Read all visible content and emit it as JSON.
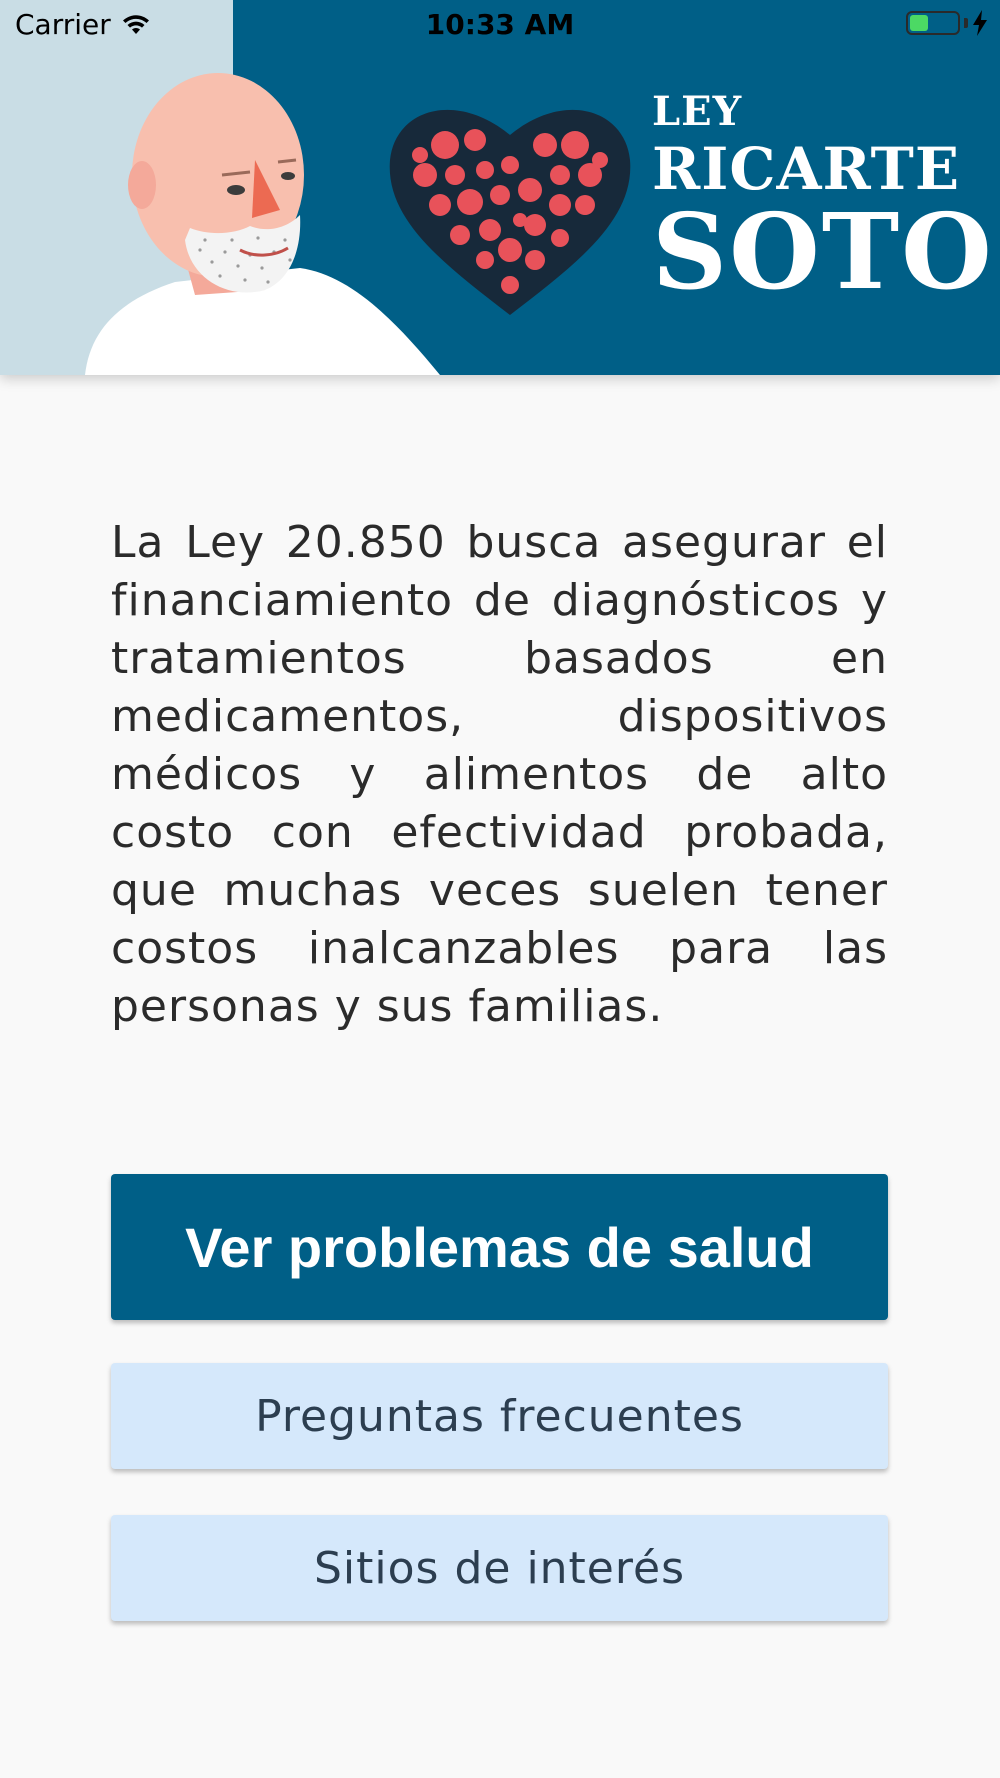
{
  "status_bar": {
    "carrier": "Carrier",
    "time": "10:33 AM",
    "battery_level": 0.4
  },
  "banner": {
    "logo_line1": "LEY",
    "logo_line2": "RICARTE",
    "logo_line3": "SOTO",
    "colors": {
      "background": "#005f87",
      "heart": "#e8525a",
      "heart_outline": "#17293a"
    }
  },
  "intro_text": "La Ley 20.850 busca asegurar el financiamiento de diagnósticos y tratamientos basados en medicamentos, dispositivos médicos y alimentos de alto costo con efectividad probada, que muchas veces suelen tener costos inalcanzables para las personas y sus familias.",
  "buttons": {
    "health_problems": "Ver problemas de salud",
    "faq": "Preguntas frecuentes",
    "sites": "Sitios de interés"
  },
  "colors": {
    "primary": "#005f87",
    "secondary_button": "#d5e8fb",
    "page_background": "#f9f9f9"
  }
}
